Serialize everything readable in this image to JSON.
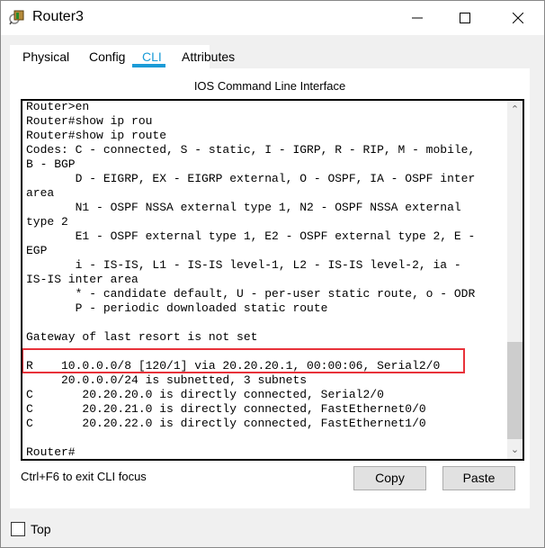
{
  "window": {
    "title": "Router3",
    "minimize_icon": "minimize-icon",
    "maximize_icon": "maximize-icon",
    "close_icon": "close-icon"
  },
  "tabs": [
    {
      "label": "Physical",
      "active": false
    },
    {
      "label": "Config",
      "active": false
    },
    {
      "label": "CLI",
      "active": true
    },
    {
      "label": "Attributes",
      "active": false
    }
  ],
  "cli": {
    "title": "IOS Command Line Interface",
    "lines": [
      "Router>en",
      "Router#show ip rou",
      "Router#show ip route",
      "Codes: C - connected, S - static, I - IGRP, R - RIP, M - mobile,",
      "B - BGP",
      "       D - EIGRP, EX - EIGRP external, O - OSPF, IA - OSPF inter",
      "area",
      "       N1 - OSPF NSSA external type 1, N2 - OSPF NSSA external",
      "type 2",
      "       E1 - OSPF external type 1, E2 - OSPF external type 2, E -",
      "EGP",
      "       i - IS-IS, L1 - IS-IS level-1, L2 - IS-IS level-2, ia -",
      "IS-IS inter area",
      "       * - candidate default, U - per-user static route, o - ODR",
      "       P - periodic downloaded static route",
      "",
      "Gateway of last resort is not set",
      "",
      "R    10.0.0.0/8 [120/1] via 20.20.20.1, 00:00:06, Serial2/0",
      "     20.0.0.0/24 is subnetted, 3 subnets",
      "C       20.20.20.0 is directly connected, Serial2/0",
      "C       20.20.21.0 is directly connected, FastEthernet0/0",
      "C       20.20.22.0 is directly connected, FastEthernet1/0",
      "",
      "Router#"
    ],
    "highlight_color": "#e8323a",
    "exit_hint": "Ctrl+F6 to exit CLI focus",
    "copy_label": "Copy",
    "paste_label": "Paste"
  },
  "top_checkbox": {
    "label": "Top",
    "checked": false
  },
  "colors": {
    "accent": "#1a9bd7"
  }
}
